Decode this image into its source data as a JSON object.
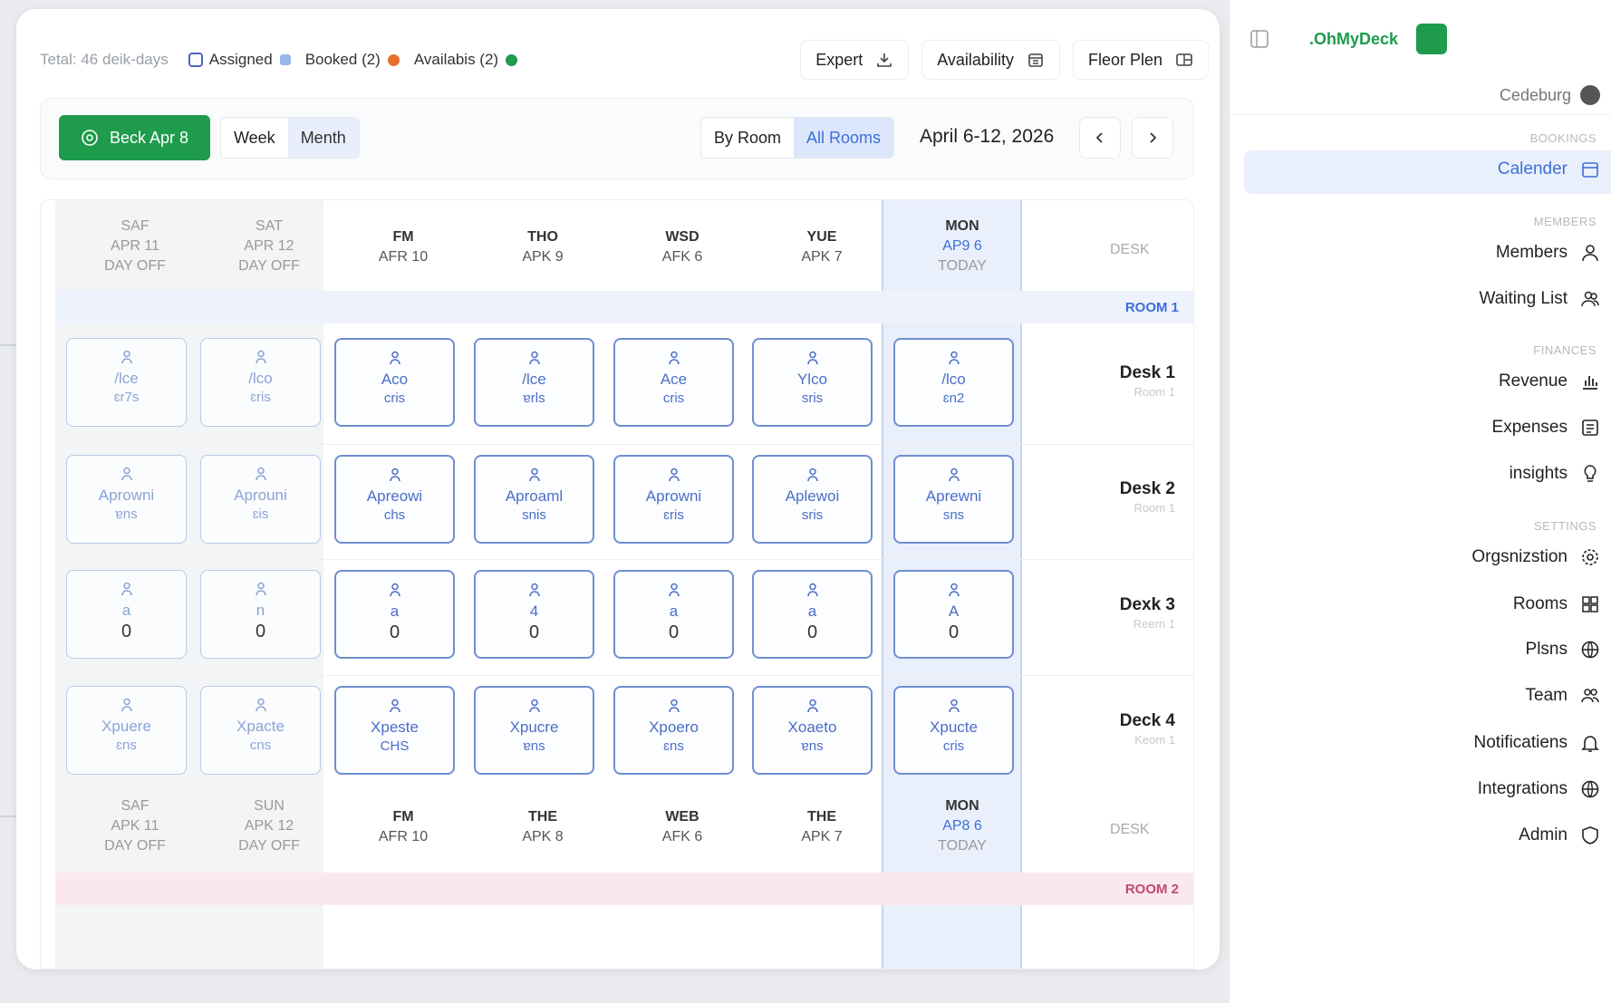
{
  "topbar": {
    "total": "Tetal: 46 deik-days",
    "legend": [
      {
        "label": "Assigned",
        "color": "#9ab7ea"
      },
      {
        "label": "Booked (2)",
        "color": "#e8702a"
      },
      {
        "label": "Availabis (2)",
        "color": "#1e9b4b"
      }
    ],
    "buttons": [
      {
        "label": "Expert",
        "icon": "download-icon"
      },
      {
        "label": "Availability",
        "icon": "calendar-icon"
      },
      {
        "label": "Fleor Plen",
        "icon": "floorplan-icon"
      }
    ]
  },
  "toolbar": {
    "book_label": "Beck Apr 8",
    "view_tabs": [
      "Week",
      "Menth"
    ],
    "filter_tabs": [
      "By Room",
      "All Rooms"
    ],
    "date_range": "April 6-12, 2026"
  },
  "days": [
    {
      "d1": "SAF",
      "d2": "APR 11",
      "d3": "DAY OFF",
      "kind": "off"
    },
    {
      "d1": "SAT",
      "d2": "APR 12",
      "d3": "DAY OFF",
      "kind": "off"
    },
    {
      "d1": "FM",
      "d2": "AFR 10",
      "d3": "",
      "kind": "work"
    },
    {
      "d1": "THO",
      "d2": "APK 9",
      "d3": "",
      "kind": "work"
    },
    {
      "d1": "WSD",
      "d2": "AFK 6",
      "d3": "",
      "kind": "work"
    },
    {
      "d1": "YUE",
      "d2": "APK 7",
      "d3": "",
      "kind": "work"
    },
    {
      "d1": "MON",
      "d2": "AP9 6",
      "d3": "TODAY",
      "kind": "today"
    }
  ],
  "days_footer": [
    {
      "d1": "SAF",
      "d2": "APK 11",
      "d3": "DAY OFF",
      "kind": "off"
    },
    {
      "d1": "SUN",
      "d2": "APK 12",
      "d3": "DAY OFF",
      "kind": "off"
    },
    {
      "d1": "FM",
      "d2": "AFR 10",
      "d3": "",
      "kind": "work"
    },
    {
      "d1": "THE",
      "d2": "APK 8",
      "d3": "",
      "kind": "work"
    },
    {
      "d1": "WEB",
      "d2": "AFK 6",
      "d3": "",
      "kind": "work"
    },
    {
      "d1": "THE",
      "d2": "APK 7",
      "d3": "",
      "kind": "work"
    },
    {
      "d1": "MON",
      "d2": "AP8 6",
      "d3": "TODAY",
      "kind": "today"
    }
  ],
  "desk_header": "DESK",
  "room1_label": "ROOM 1",
  "room2_label": "ROOM 2",
  "desks": [
    {
      "name": "Desk 1",
      "room": "Room 1",
      "cells": [
        {
          "name": "/lce",
          "sub": "ɛr7s"
        },
        {
          "name": "/lco",
          "sub": "ɛris"
        },
        {
          "name": "Aco",
          "sub": "cris"
        },
        {
          "name": "/lce",
          "sub": "ɐrls"
        },
        {
          "name": "Ace",
          "sub": "cris"
        },
        {
          "name": "Ylco",
          "sub": "sris"
        },
        {
          "name": "/lco",
          "sub": "ɛn2"
        }
      ]
    },
    {
      "name": "Desk 2",
      "room": "Room 1",
      "cells": [
        {
          "name": "Aprowni",
          "sub": "ɐns"
        },
        {
          "name": "Aprouni",
          "sub": "ɛis"
        },
        {
          "name": "Apreowi",
          "sub": "chs"
        },
        {
          "name": "Aproaml",
          "sub": "snis"
        },
        {
          "name": "Aprowni",
          "sub": "ɛris"
        },
        {
          "name": "Aplewoi",
          "sub": "sris"
        },
        {
          "name": "Aprewni",
          "sub": "sns"
        }
      ]
    },
    {
      "name": "Dexk 3",
      "room": "Reern 1",
      "cells": [
        {
          "name": "a",
          "zero": "0"
        },
        {
          "name": "n",
          "zero": "0"
        },
        {
          "name": "a",
          "zero": "0"
        },
        {
          "name": "4",
          "zero": "0"
        },
        {
          "name": "a",
          "zero": "0"
        },
        {
          "name": "a",
          "zero": "0"
        },
        {
          "name": "A",
          "zero": "0"
        }
      ]
    },
    {
      "name": "Deck 4",
      "room": "Keom 1",
      "cells": [
        {
          "name": "Xpuere",
          "sub": "ɛns"
        },
        {
          "name": "Xpacte",
          "sub": "cns"
        },
        {
          "name": "Xpeste",
          "sub": "CHS"
        },
        {
          "name": "Xpucre",
          "sub": "ɐns"
        },
        {
          "name": "Xpoero",
          "sub": "ɛns"
        },
        {
          "name": "Xoaeto",
          "sub": "ɐns"
        },
        {
          "name": "Xpucte",
          "sub": "cris"
        }
      ]
    }
  ],
  "sidebar": {
    "logo": ".OhMyDeck",
    "org": "Cedeburg",
    "sections": [
      {
        "title": "BOOKINGS",
        "items": [
          {
            "label": "Calender",
            "icon": "calendar-icon",
            "active": true
          }
        ]
      },
      {
        "title": "MEMBERS",
        "items": [
          {
            "label": "Members",
            "icon": "user-icon"
          },
          {
            "label": "Waiting List",
            "icon": "users-icon"
          }
        ]
      },
      {
        "title": "FINANCES",
        "items": [
          {
            "label": "Revenue",
            "icon": "bar-chart-icon"
          },
          {
            "label": "Expenses",
            "icon": "receipt-icon"
          },
          {
            "label": "insights",
            "icon": "lightbulb-icon"
          }
        ]
      },
      {
        "title": "SETTINGS",
        "items": [
          {
            "label": "Orgsnizstion",
            "icon": "gear-icon"
          },
          {
            "label": "Rooms",
            "icon": "grid-icon"
          },
          {
            "label": "Plsns",
            "icon": "globe-icon"
          },
          {
            "label": "Team",
            "icon": "team-icon"
          },
          {
            "label": "Notificatiens",
            "icon": "bell-icon"
          },
          {
            "label": "Integrations",
            "icon": "globe-icon"
          },
          {
            "label": "Admin",
            "icon": "shield-icon"
          }
        ]
      }
    ]
  }
}
